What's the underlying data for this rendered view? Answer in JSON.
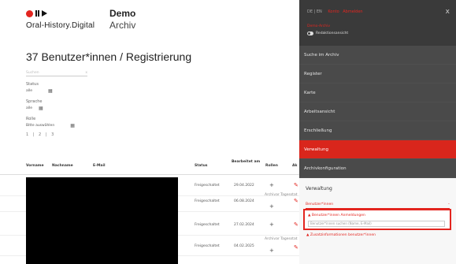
{
  "header": {
    "logo_text": "Oral-History.Digital",
    "brand_title": "Demo",
    "brand_subtitle": "Archiv"
  },
  "page": {
    "title": "37 Benutzer*innen / Registrierung"
  },
  "filters": {
    "search_placeholder": "Suchen",
    "search_icon": "x",
    "status_label": "Status",
    "status_value": "alle",
    "language_label": "Sprache",
    "language_value": "alle",
    "role_label": "Rolle",
    "role_value": "Bitte auswählen",
    "pagination": "1 | 2 | 3"
  },
  "table": {
    "headers": {
      "firstname": "Vorname",
      "lastname": "Nachname",
      "email": "E-Mail",
      "status": "Status",
      "processed": "Bearbeitet am",
      "roles": "Rollen",
      "actions": "Ak"
    },
    "rows": [
      {
        "status": "Freigeschaltet",
        "date": "29.04.2022",
        "roles": ""
      },
      {
        "status": "Freigeschaltet",
        "date": "06.08.2024",
        "roles": "Archivar Tagesstat"
      },
      {
        "status": "Freigeschaltet",
        "date": "27.02.2024",
        "roles": ""
      },
      {
        "status": "Freigeschaltet",
        "date": "04.02.2025",
        "roles": "Archivar Tagesstat"
      }
    ]
  },
  "overlay": {
    "language": "DE | EN",
    "user_links": [
      "Konto",
      "Abmelden"
    ],
    "close_icon": "x",
    "archive_label": "Demo-Archiv",
    "toggle_label": "Redaktionsansicht",
    "nav": [
      {
        "label": "Suche im Archiv",
        "active": false
      },
      {
        "label": "Register",
        "active": false
      },
      {
        "label": "Karte",
        "active": false
      },
      {
        "label": "Arbeitsansicht",
        "active": false
      },
      {
        "label": "Erschließung",
        "active": false
      },
      {
        "label": "Verwaltung",
        "active": true
      },
      {
        "label": "Archivkonfiguration",
        "active": false
      }
    ],
    "section_title": "Verwaltung",
    "sub_items": {
      "collapsed": "Benutzer*innen",
      "collapsed_icon": "–",
      "highlighted": "Benutzer*innen Anmeldungen",
      "search_placeholder": "Benutzer*innen suchen (Name, E-Mail)",
      "after": "Zusatzinformationen benutzer*innen"
    },
    "colors": {
      "accent": "#e3251f",
      "panel": "#3a3a3a"
    }
  }
}
